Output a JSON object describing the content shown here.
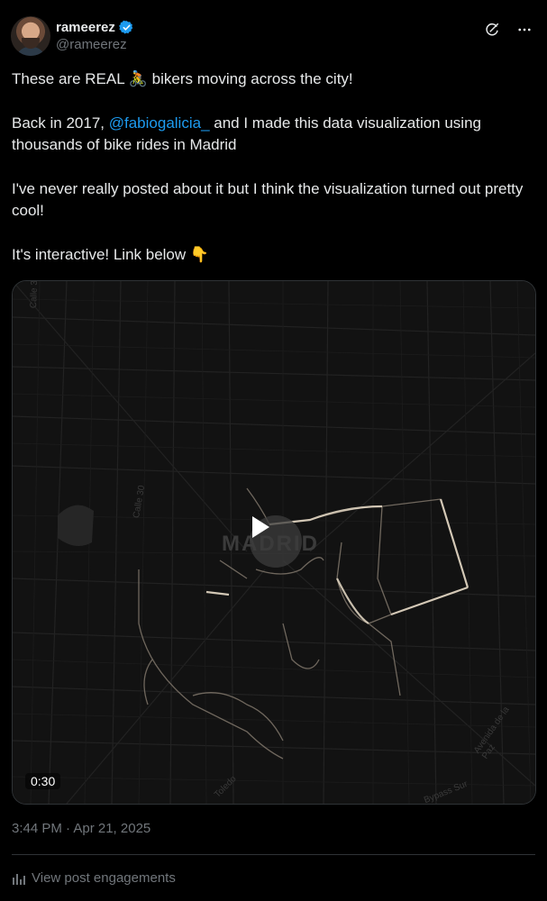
{
  "author": {
    "display_name": "rameerez",
    "handle": "@rameerez",
    "verified_color": "#1d9bf0"
  },
  "header_icons": [
    "grok-icon",
    "more-icon"
  ],
  "post": {
    "line1_before": "These are REAL ",
    "line1_emoji": "🚴",
    "line1_after": " bikers moving across the city!",
    "p2_before": "Back in 2017, ",
    "p2_mention": "@fabiogalicia_",
    "p2_after": " and I made this data visualization using thousands of bike rides in Madrid",
    "p3": "I've never really posted about it but I think the visualization turned out pretty cool!",
    "p4_text": "It's interactive! Link below ",
    "p4_emoji": "👇"
  },
  "media": {
    "map_label": "MADRID",
    "duration": "0:30",
    "street_labels": [
      "Calle 30",
      "Calle 30",
      "Avenida de la Paz",
      "Bypass Sur",
      "Toledo"
    ]
  },
  "timestamp": "3:44 PM · Apr 21, 2025",
  "engagements_label": "View post engagements",
  "colors": {
    "background": "#000000",
    "text": "#e7e9ea",
    "muted": "#71767b",
    "link": "#1d9bf0"
  }
}
